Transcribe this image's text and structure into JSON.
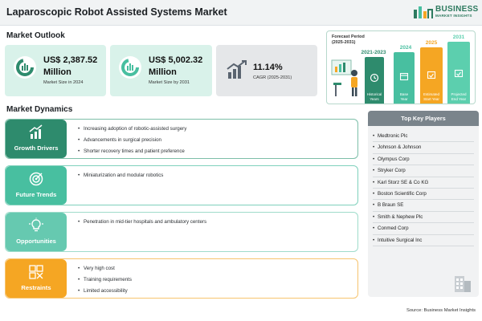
{
  "header": {
    "title": "Laparoscopic Robot Assisted Systems Market"
  },
  "logo": {
    "brand": "BUSINESS",
    "tagline": "MARKET INSIGHTS"
  },
  "outlook": {
    "title": "Market Outlook",
    "stats": [
      {
        "value_line1": "US$ 2,387.52",
        "value_line2": "Million",
        "caption": "Market Size in 2024",
        "icon": "pie-chart-icon"
      },
      {
        "value_line1": "US$ 5,002.32",
        "value_line2": "Million",
        "caption": "Market Size by 2031",
        "icon": "pie-chart-icon"
      },
      {
        "value": "11.14%",
        "caption": "CAGR (2025-2031)",
        "icon": "growth-chart-icon"
      }
    ]
  },
  "forecast": {
    "period_label_line1": "Forecast Period",
    "period_label_line2": "(2025-2031)",
    "bars": [
      {
        "year": "2021-2023",
        "label_line1": "Historical",
        "label_line2": "Years",
        "color": "#2e8b6d",
        "icon": "history-icon"
      },
      {
        "year": "2024",
        "label_line1": "Base",
        "label_line2": "Year",
        "color": "#48bfa0",
        "icon": "calendar-icon"
      },
      {
        "year": "2025",
        "label_line1": "Estimated",
        "label_line2": "Start Year",
        "color": "#f5a623",
        "icon": "calendar-check-icon"
      },
      {
        "year": "2031",
        "label_line1": "Projected",
        "label_line2": "End Year",
        "color": "#5ccfae",
        "icon": "calendar-check-icon"
      }
    ]
  },
  "dynamics": {
    "title": "Market Dynamics",
    "rows": [
      {
        "label": "Growth Drivers",
        "color": "#2e8b6d",
        "border": "#7dbfa9",
        "icon": "growth-arrow-icon",
        "items": [
          "Increasing adoption of robotic-assisted surgery",
          "Advancements in surgical precision",
          "Shorter recovery times and patient preference"
        ]
      },
      {
        "label": "Future Trends",
        "color": "#48bfa0",
        "border": "#7fd1bc",
        "icon": "target-icon",
        "items": [
          "Miniaturization and modular robotics"
        ]
      },
      {
        "label": "Opportunities",
        "color": "#66c9b0",
        "border": "#9fdccb",
        "icon": "lightbulb-icon",
        "items": [
          "Penetration in mid-tier hospitals and ambulatory centers"
        ]
      },
      {
        "label": "Restraints",
        "color": "#f5a623",
        "border": "#f7c46f",
        "icon": "restraint-icon",
        "items": [
          "Very high cost",
          "Training requirements",
          "Limited accessibility"
        ]
      }
    ]
  },
  "players": {
    "title": "Top Key Players",
    "items": [
      "Medtronic Plc",
      "Johnson & Johnson",
      "Olympus Corp",
      "Stryker Corp",
      "Karl Storz SE & Co KG",
      "Boston Scientific Corp",
      "B Braun SE",
      "Smith & Nephew Plc",
      "Conmed Corp",
      "Intuitive Surgical Inc"
    ]
  },
  "footer": {
    "source": "Source: Business Market Insights"
  }
}
